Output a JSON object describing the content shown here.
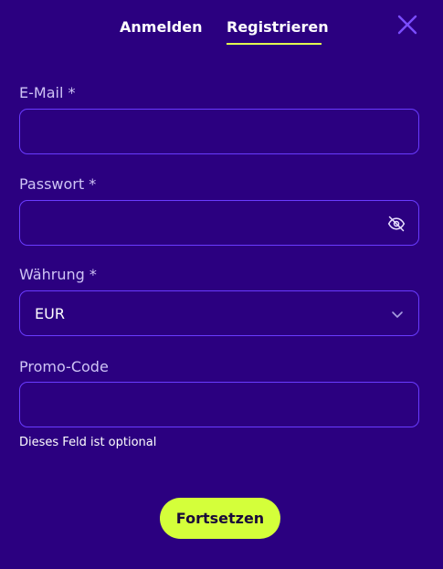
{
  "tabs": {
    "login": "Anmelden",
    "register": "Registrieren",
    "active": "register"
  },
  "close_icon": "close-icon",
  "form": {
    "email": {
      "label": "E-Mail *",
      "value": "",
      "placeholder": ""
    },
    "password": {
      "label": "Passwort *",
      "value": "",
      "placeholder": "",
      "toggle_icon": "eye-off-icon"
    },
    "currency": {
      "label": "Währung *",
      "selected": "EUR",
      "icon": "chevron-down-icon"
    },
    "promo": {
      "label": "Promo-Code",
      "value": "",
      "placeholder": "",
      "hint": "Dieses Feld ist optional"
    }
  },
  "submit_label": "Fortsetzen",
  "colors": {
    "background": "#2b0080",
    "accent": "#d4ff3a",
    "border": "#6a3bff",
    "label": "#cfc4f5",
    "close": "#7b4dff"
  }
}
